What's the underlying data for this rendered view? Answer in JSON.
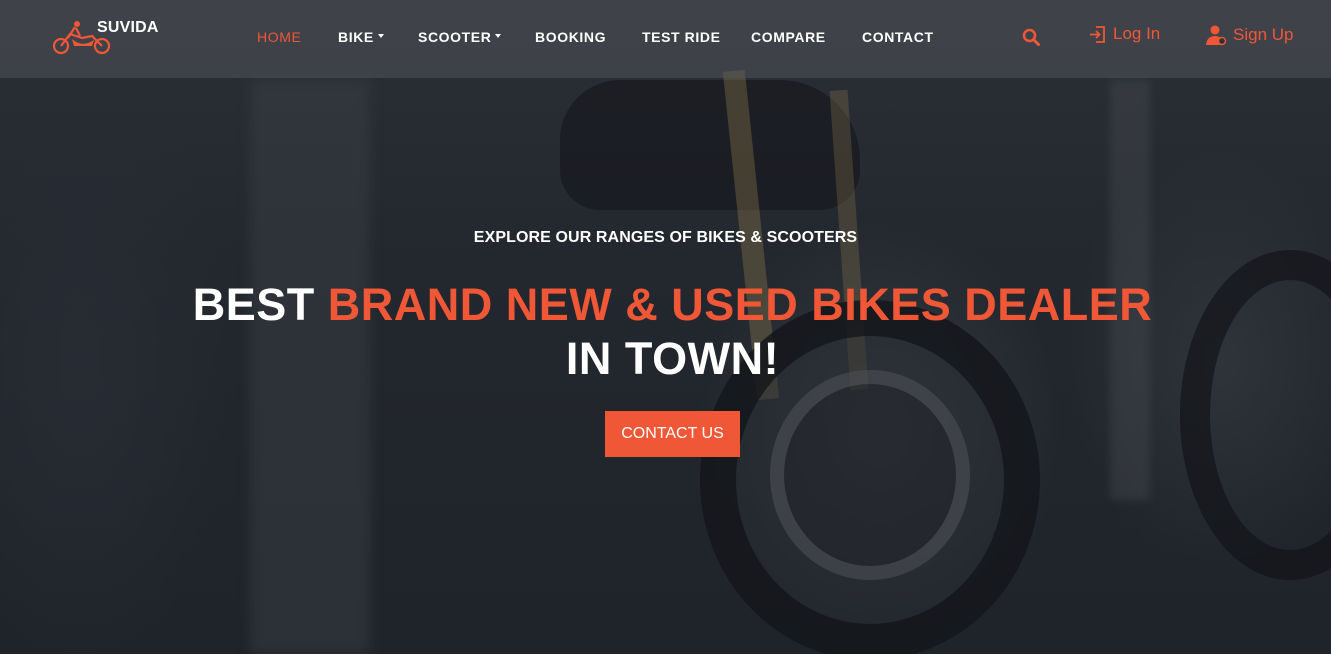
{
  "brand": {
    "name": "SUVIDA",
    "logo_icon": "motorbike-rider-icon",
    "accent_color": "#ef5736"
  },
  "nav": {
    "items": [
      {
        "label": "HOME",
        "active": true,
        "dropdown": false
      },
      {
        "label": "BIKE",
        "active": false,
        "dropdown": true
      },
      {
        "label": "SCOOTER",
        "active": false,
        "dropdown": true
      },
      {
        "label": "BOOKING",
        "active": false,
        "dropdown": false
      },
      {
        "label": "TEST RIDE",
        "active": false,
        "dropdown": false
      },
      {
        "label": "COMPARE",
        "active": false,
        "dropdown": false
      },
      {
        "label": "CONTACT",
        "active": false,
        "dropdown": false
      }
    ],
    "search_icon": "search-icon",
    "login_label": "Log In",
    "login_icon": "login-icon",
    "signup_label": "Sign Up",
    "signup_icon": "user-icon"
  },
  "hero": {
    "eyebrow": "EXPLORE OUR RANGES OF BIKES & SCOOTERS",
    "headline_pre": "BEST ",
    "headline_accent": "BRAND NEW & USED BIKES DEALER",
    "headline_post": " IN TOWN!",
    "cta_label": "CONTACT US"
  }
}
